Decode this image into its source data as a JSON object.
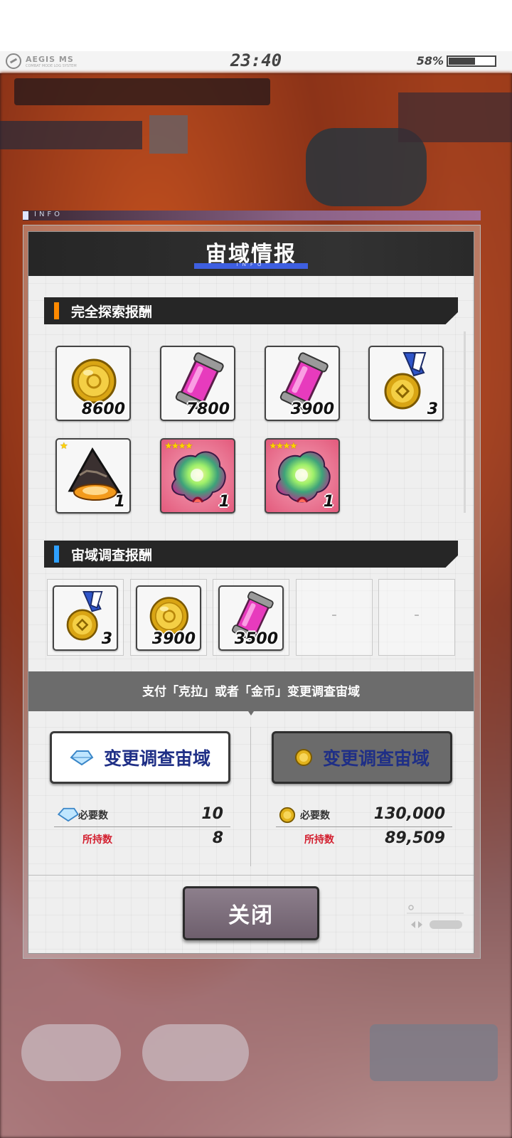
{
  "status_bar": {
    "brand": "AEGIS MS",
    "brand_sub": "COMBAT MODE LOG SYSTEM",
    "time": "23:40",
    "battery_percent": "58%",
    "battery_level": 0.58
  },
  "info_tag": "INFO",
  "modal": {
    "title": "宙域情报",
    "title_sub": "INFO",
    "section_full": {
      "title": "完全探索报酬",
      "bar_color": "#ff8a00",
      "items": [
        {
          "icon": "gold-coin-icon",
          "qty": "8600"
        },
        {
          "icon": "pink-energy-canister-icon",
          "qty": "7800"
        },
        {
          "icon": "pink-energy-canister-icon",
          "qty": "3900"
        },
        {
          "icon": "medal-icon",
          "qty": "3"
        },
        {
          "icon": "dark-shell-item-icon",
          "qty": "1",
          "stars": "★"
        },
        {
          "icon": "rainbow-core-item-icon",
          "qty": "1",
          "stars": "★★★★"
        },
        {
          "icon": "rainbow-core-item-icon",
          "qty": "1",
          "stars": "★★★★"
        }
      ]
    },
    "section_survey": {
      "title": "宙域调查报酬",
      "bar_color": "#2ea0ff",
      "items": [
        {
          "icon": "medal-icon",
          "qty": "3"
        },
        {
          "icon": "gold-coin-icon",
          "qty": "3900"
        },
        {
          "icon": "pink-energy-canister-icon",
          "qty": "3500"
        }
      ],
      "empty_slots": [
        "-",
        "-"
      ]
    },
    "pay_prompt": "支付「克拉」或者「金币」变更调查宙域",
    "left_option": {
      "button_label": "变更调查宙域",
      "currency_icon": "crystal-icon",
      "required_label": "必要数",
      "required_value": "10",
      "owned_label": "所持数",
      "owned_value": "8"
    },
    "right_option": {
      "button_label": "变更调查宙域",
      "currency_icon": "gold-coin-icon",
      "required_label": "必要数",
      "required_value": "130,000",
      "owned_label": "所持数",
      "owned_value": "89,509"
    },
    "close_label": "关闭"
  }
}
